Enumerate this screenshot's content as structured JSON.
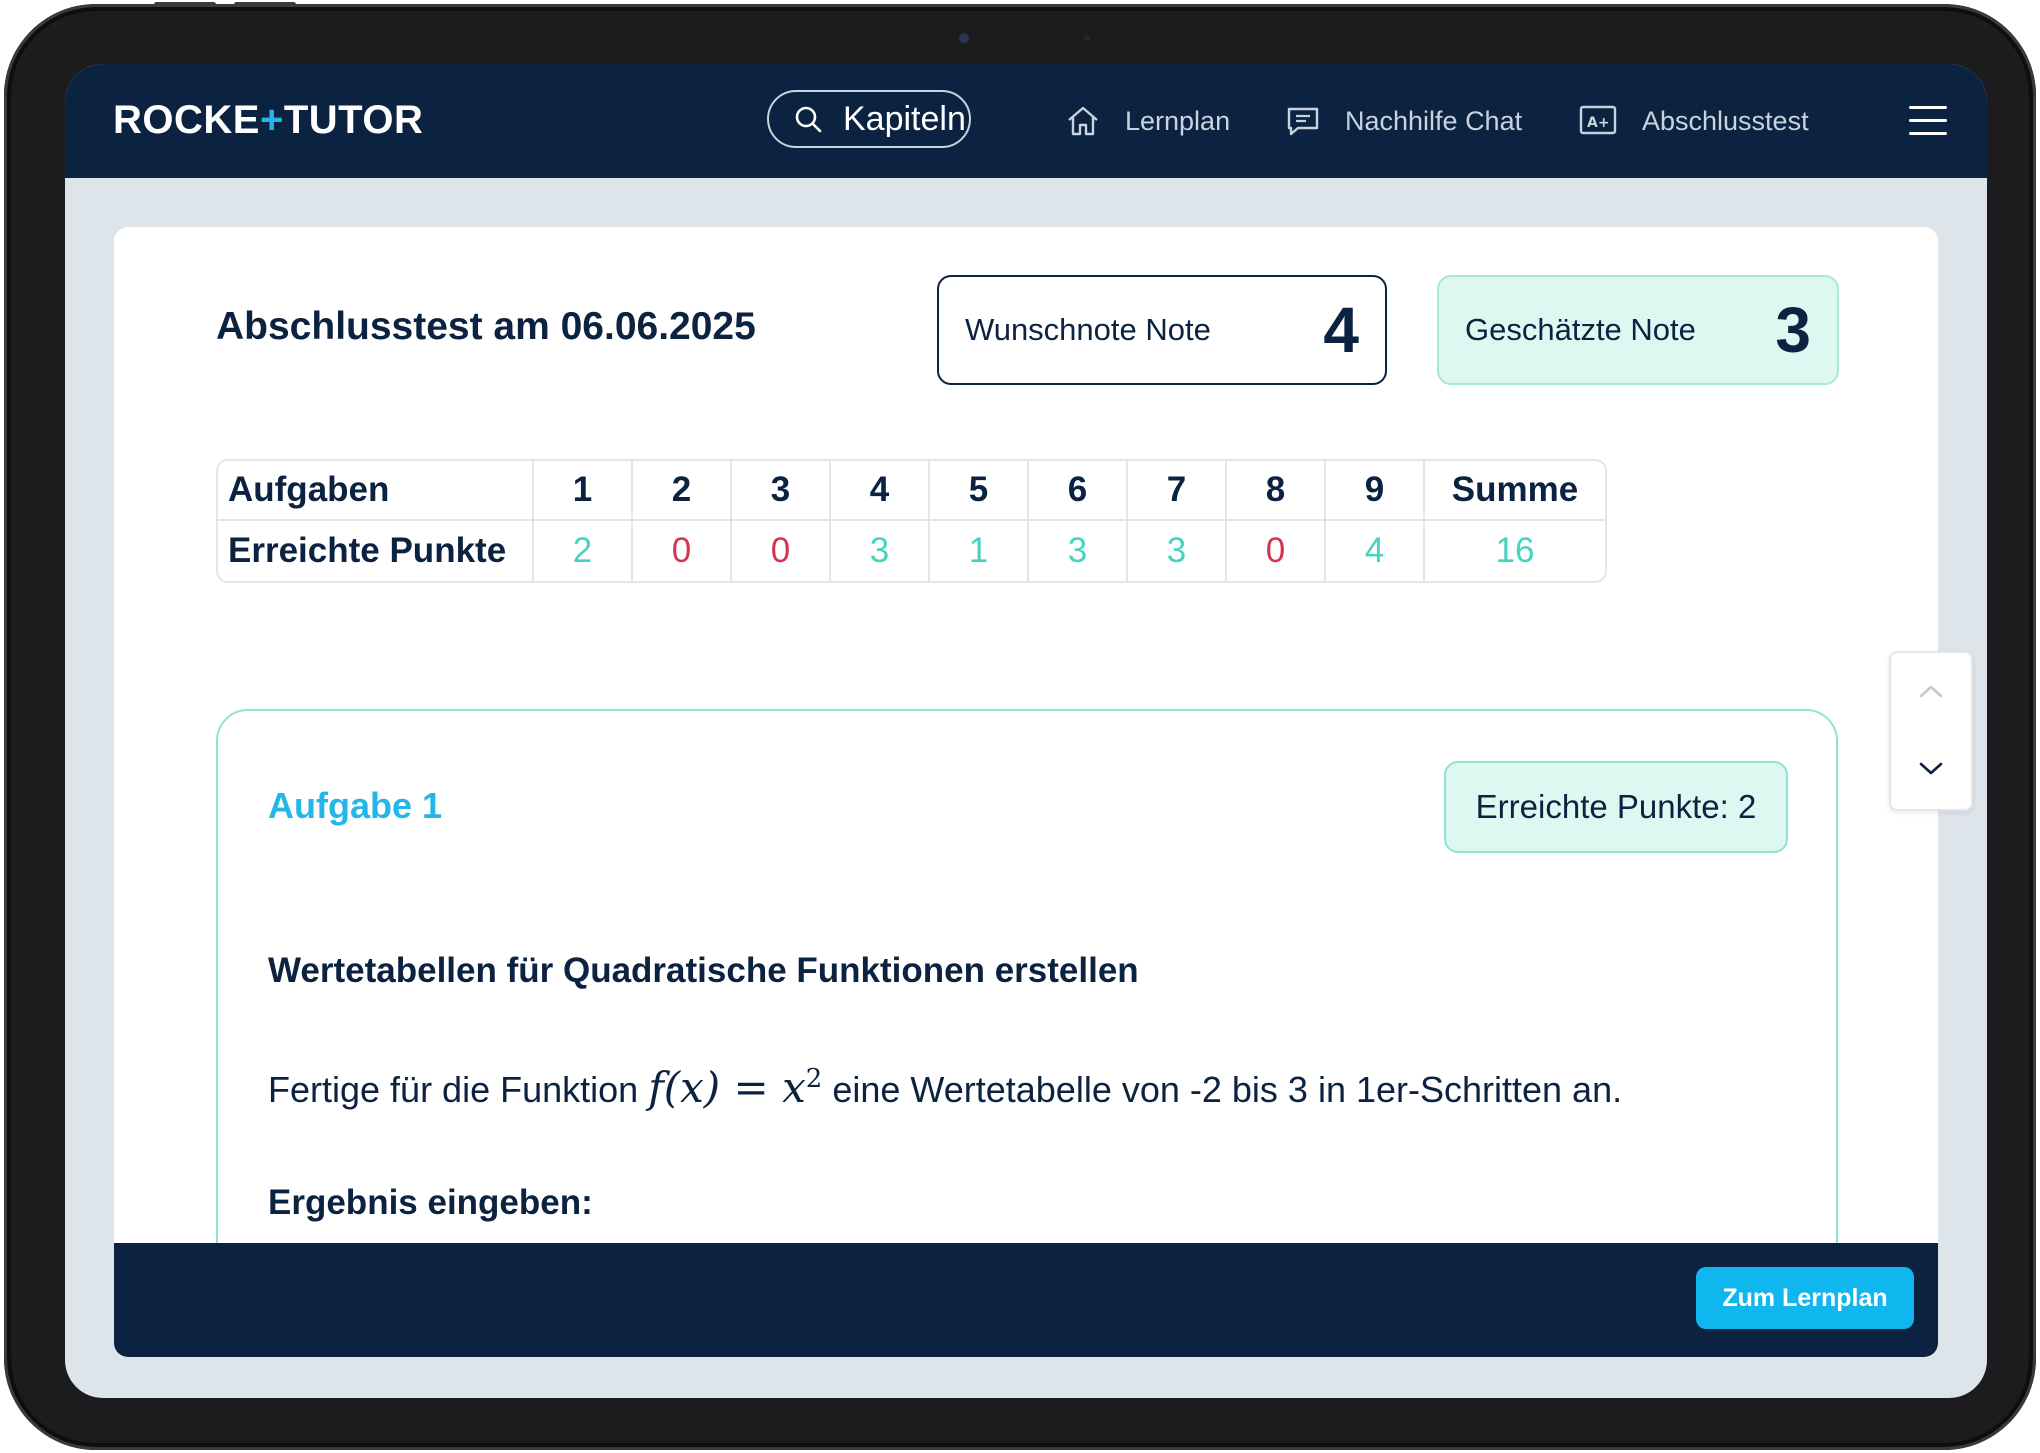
{
  "nav": {
    "logo": {
      "part1": "ROCKE",
      "plus": "+",
      "part2": "TUTOR"
    },
    "search_label": "Kapiteln",
    "links": [
      {
        "label": "Lernplan",
        "icon": "home-icon"
      },
      {
        "label": "Nachhilfe Chat",
        "icon": "chat-icon"
      },
      {
        "label": "Abschlusstest",
        "icon": "grade-icon"
      }
    ],
    "menu_icon": "hamburger-menu-icon"
  },
  "test": {
    "title": "Abschlusstest am 06.06.2025",
    "wish_grade": {
      "label": "Wunschnote Note",
      "value": "4"
    },
    "estimated_grade": {
      "label": "Geschätzte Note",
      "value": "3"
    }
  },
  "scores": {
    "row_labels": [
      "Aufgaben",
      "Erreichte Punkte"
    ],
    "tasks": [
      "1",
      "2",
      "3",
      "4",
      "5",
      "6",
      "7",
      "8",
      "9"
    ],
    "points": [
      "2",
      "0",
      "0",
      "3",
      "1",
      "3",
      "3",
      "0",
      "4"
    ],
    "sum_label": "Summe",
    "sum_value": "16"
  },
  "task": {
    "title": "Aufgabe 1",
    "points_badge": "Erreichte Punkte: 2",
    "subtitle": "Wertetabellen für Quadratische Funktionen erstellen",
    "text_before": "Fertige für die Funktion ",
    "math": "f(x) = x",
    "math_exp": "2",
    "text_after": " eine Wertetabelle von -2 bis 3 in 1er-Schritten an.",
    "result_label": "Ergebnis eingeben:"
  },
  "footer": {
    "cta_label": "Zum Lernplan"
  },
  "colors": {
    "navy": "#0b2240",
    "accent": "#22b7e8",
    "positive": "#47d3bf",
    "zero": "#d9324f",
    "mint_bg": "#dff7f1"
  }
}
